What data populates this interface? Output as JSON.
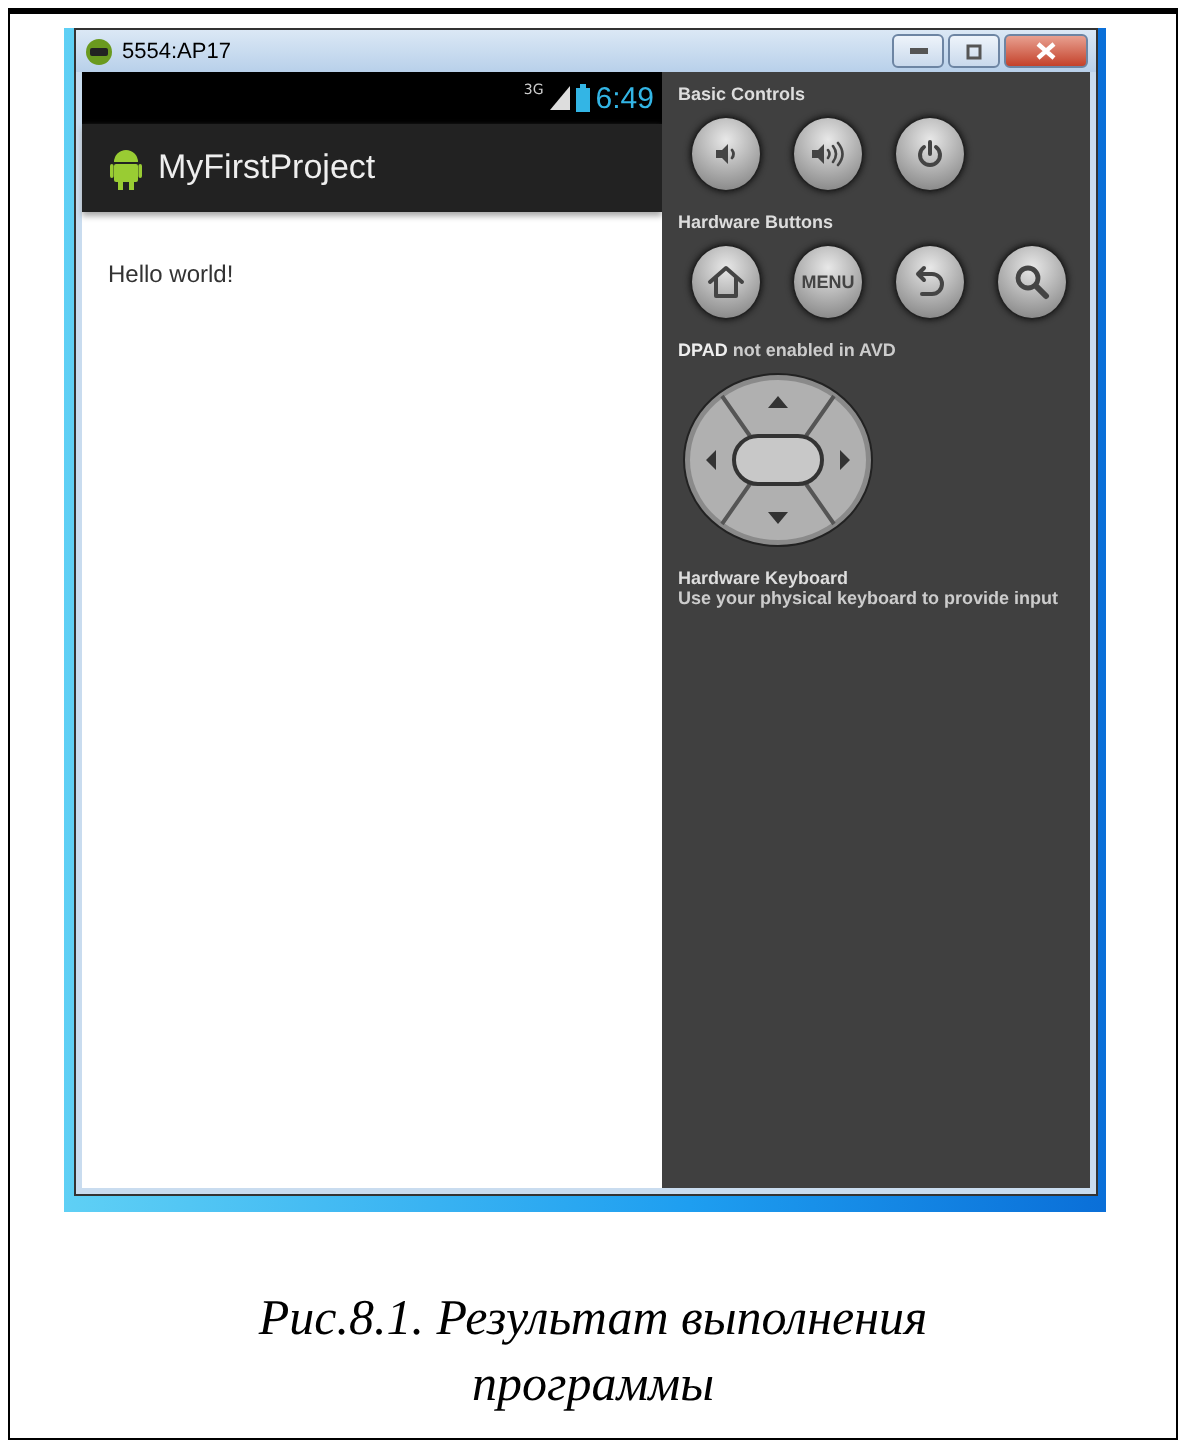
{
  "window": {
    "title": "5554:AP17"
  },
  "phone": {
    "status_bar": {
      "network": "3G",
      "time": "6:49"
    },
    "app_title": "MyFirstProject",
    "content_text": "Hello world!"
  },
  "panel": {
    "sections": [
      {
        "kind": "buttons",
        "label": "Basic Controls",
        "buttons": [
          {
            "kind": "volume-down"
          },
          {
            "kind": "volume-up"
          },
          {
            "kind": "power"
          }
        ]
      },
      {
        "kind": "buttons",
        "label": "Hardware Buttons",
        "buttons": [
          {
            "kind": "home"
          },
          {
            "kind": "menu",
            "label": "MENU"
          },
          {
            "kind": "back"
          },
          {
            "kind": "search"
          }
        ]
      },
      {
        "kind": "dpad",
        "label": "**DPAD** not enabled in AVD"
      },
      {
        "kind": "text",
        "label": "Hardware Keyboard",
        "text": "Use your physical keyboard to provide input"
      }
    ]
  },
  "caption": "Рис.8.1. Результат выполнения программы"
}
